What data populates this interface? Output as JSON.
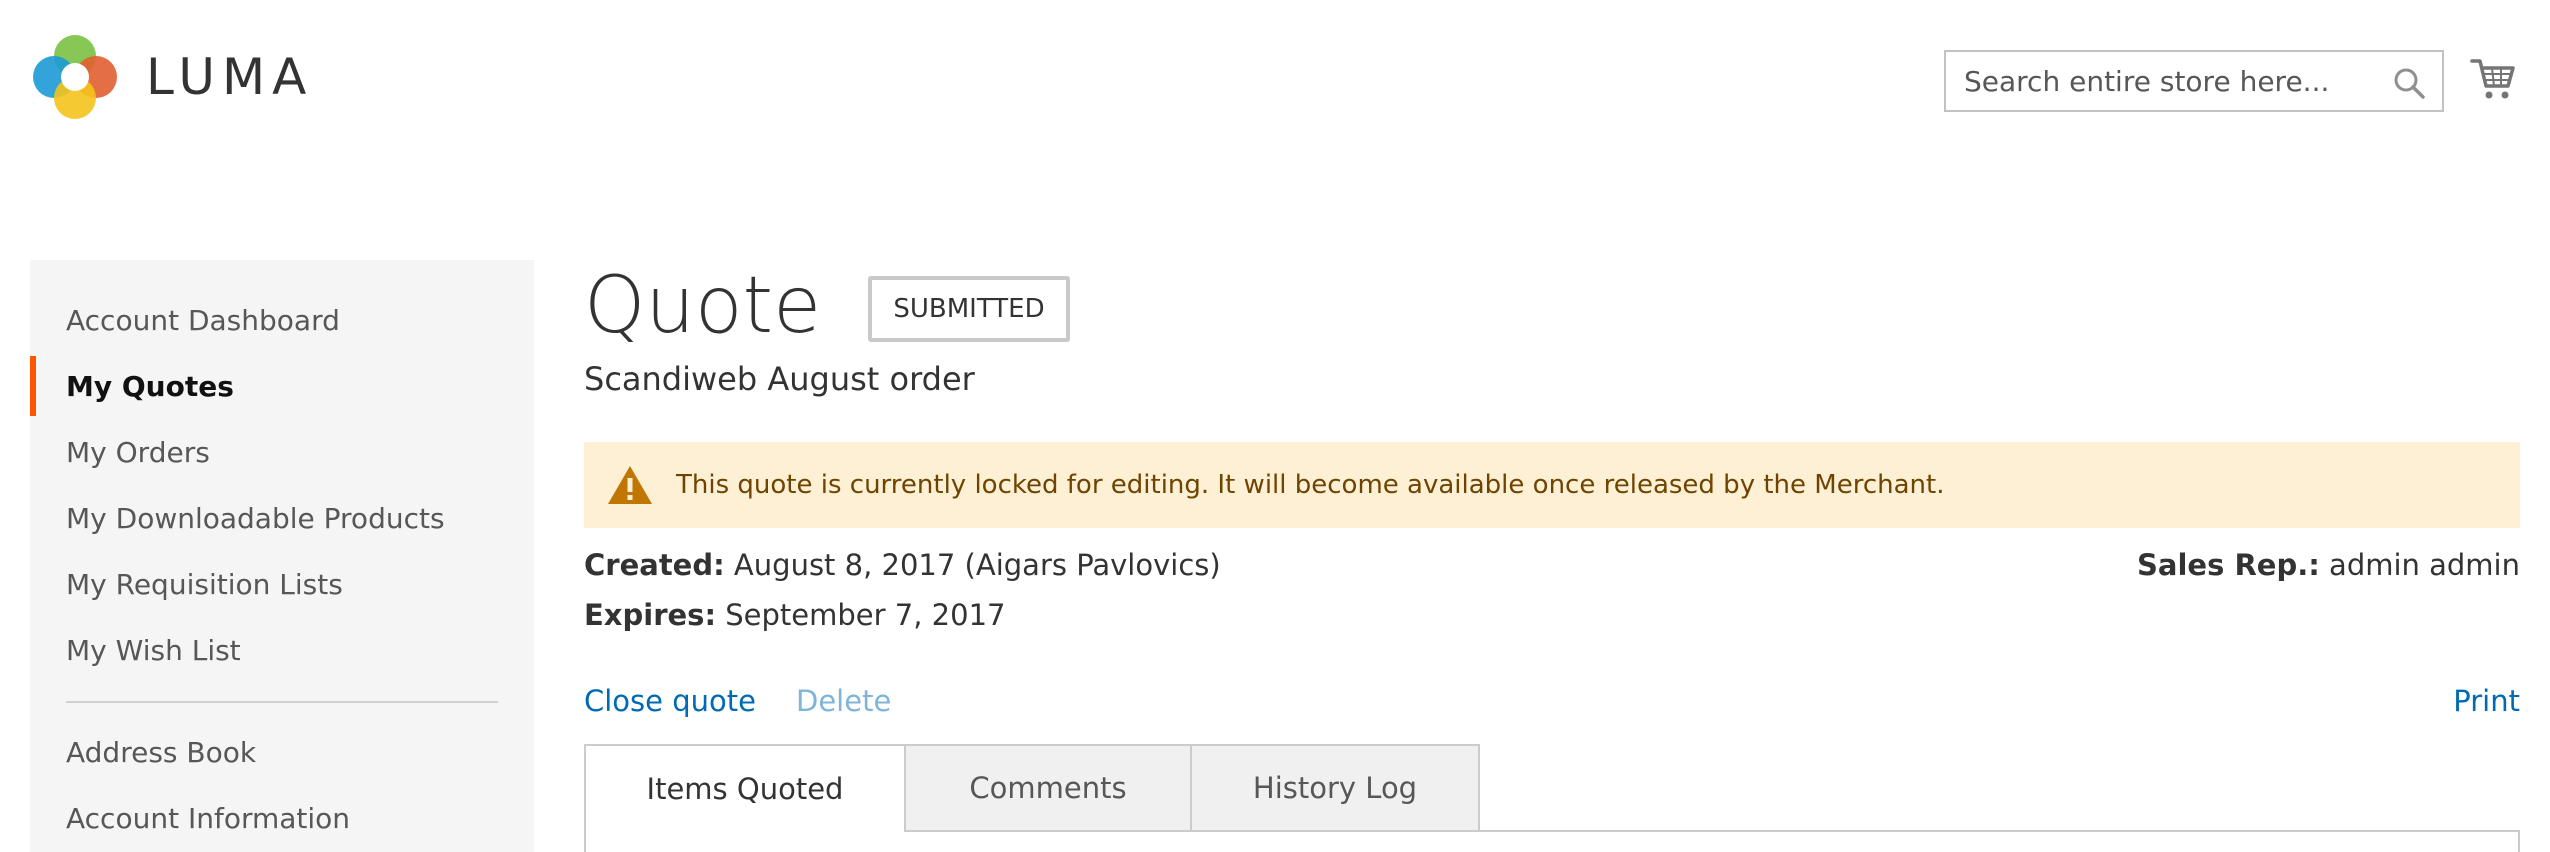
{
  "header": {
    "logo_text": "LUMA",
    "search_placeholder": "Search entire store here..."
  },
  "sidebar": {
    "items": [
      {
        "label": "Account Dashboard",
        "active": false
      },
      {
        "label": "My Quotes",
        "active": true
      },
      {
        "label": "My Orders",
        "active": false
      },
      {
        "label": "My Downloadable Products",
        "active": false
      },
      {
        "label": "My Requisition Lists",
        "active": false
      },
      {
        "label": "My Wish List",
        "active": false
      }
    ],
    "secondary_items": [
      {
        "label": "Address Book"
      },
      {
        "label": "Account Information"
      }
    ]
  },
  "quote": {
    "title": "Quote",
    "status": "SUBMITTED",
    "name": "Scandiweb August order",
    "notice": "This quote is currently locked for editing. It will become available once released by the Merchant.",
    "created_label": "Created:",
    "created_value": " August 8, 2017 (Aigars Pavlovics)",
    "expires_label": "Expires:",
    "expires_value": " September 7, 2017",
    "sales_rep_label": "Sales Rep.:",
    "sales_rep_value": " admin admin"
  },
  "actions": {
    "close_quote": "Close quote",
    "delete": "Delete",
    "print": "Print"
  },
  "tabs": [
    {
      "label": "Items Quoted",
      "active": true
    },
    {
      "label": "Comments",
      "active": false
    },
    {
      "label": "History Log",
      "active": false
    }
  ],
  "colors": {
    "accent_active_nav": "#ff5501",
    "link": "#006bb4",
    "notice_background": "#fdf0d5",
    "notice_text": "#6f4400"
  }
}
